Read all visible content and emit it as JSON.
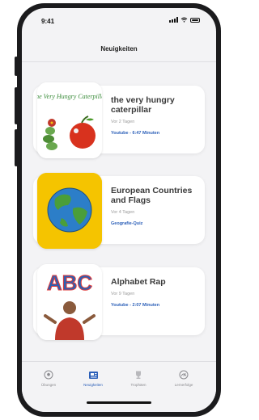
{
  "status_bar": {
    "time": "9:41"
  },
  "header": {
    "title": "Neuigkeiten"
  },
  "cards": [
    {
      "title": "the very hungry caterpillar",
      "date": "Vor 2 Tagen",
      "meta": "Youtube - 6:47 Minuten",
      "thumb_text": "The Very Hungry Caterpillar"
    },
    {
      "title": "European Countries and Flags",
      "date": "Vor 4 Tagen",
      "meta": "Geografie-Quiz"
    },
    {
      "title": "Alphabet Rap",
      "date": "Vor 9 Tagen",
      "meta": "Youtube - 2:07 Minuten",
      "thumb_text": "ABC"
    }
  ],
  "tabs": [
    {
      "label": "Übungen",
      "icon": "soccer-ball-icon"
    },
    {
      "label": "Neuigkeiten",
      "icon": "news-icon",
      "active": true
    },
    {
      "label": "Trophäen",
      "icon": "trophy-icon"
    },
    {
      "label": "Lernerfolge",
      "icon": "speedometer-icon"
    }
  ],
  "colors": {
    "accent": "#2b5fb8",
    "flag_thumb_bg": "#f5c400"
  }
}
